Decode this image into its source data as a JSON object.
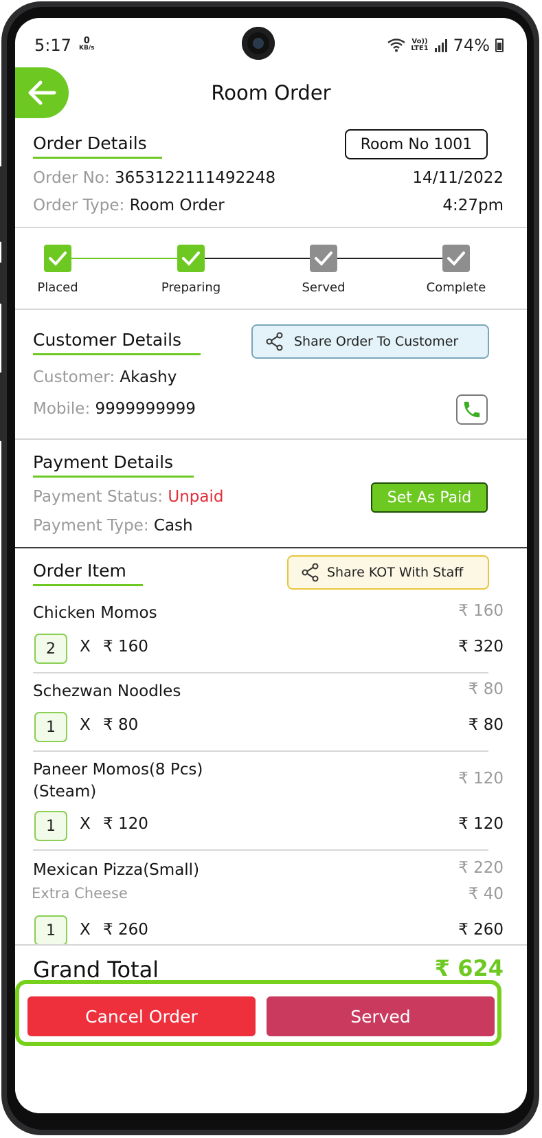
{
  "status_bar": {
    "time": "5:17",
    "net_speed_value": "0",
    "net_speed_unit": "KB/s",
    "volte_line1": "Vo))",
    "volte_line2": "LTE1",
    "battery": "74%"
  },
  "header": {
    "title": "Room Order"
  },
  "order_details": {
    "heading": "Order Details",
    "room_badge": "Room No 1001",
    "order_no_label": "Order No:",
    "order_no_value": "3653122111492248",
    "date": "14/11/2022",
    "order_type_label": "Order Type:",
    "order_type_value": "Room Order",
    "time": "4:27pm"
  },
  "progress": {
    "steps": [
      {
        "label": "Placed",
        "done": true
      },
      {
        "label": "Preparing",
        "done": true
      },
      {
        "label": "Served",
        "done": false
      },
      {
        "label": "Complete",
        "done": false
      }
    ]
  },
  "customer_details": {
    "heading": "Customer Details",
    "share_button": "Share Order To Customer",
    "customer_label": "Customer:",
    "customer_value": "Akashy",
    "mobile_label": "Mobile:",
    "mobile_value": "9999999999"
  },
  "payment_details": {
    "heading": "Payment Details",
    "status_label": "Payment Status:",
    "status_value": "Unpaid",
    "set_paid_button": "Set As Paid",
    "type_label": "Payment Type:",
    "type_value": "Cash"
  },
  "order_items": {
    "heading": "Order Item",
    "share_kot_button": "Share KOT With Staff",
    "items": [
      {
        "name": "Chicken Momos",
        "unit_price": "₹ 160",
        "qty": "2",
        "x": "X",
        "price_each": "₹ 160",
        "line_total": "₹ 320"
      },
      {
        "name": "Schezwan Noodles",
        "unit_price": "₹ 80",
        "qty": "1",
        "x": "X",
        "price_each": "₹ 80",
        "line_total": "₹ 80"
      },
      {
        "name_line1": "Paneer Momos(8 Pcs)",
        "name_line2": "(Steam)",
        "unit_price": "₹ 120",
        "qty": "1",
        "x": "X",
        "price_each": "₹ 120",
        "line_total": "₹ 120"
      },
      {
        "name": "Mexican Pizza(Small)",
        "unit_price": "₹ 220",
        "addon": "Extra Cheese",
        "addon_price": "₹ 40",
        "qty": "1",
        "x": "X",
        "price_each": "₹ 260",
        "line_total": "₹ 260"
      }
    ]
  },
  "footer": {
    "grand_total_label": "Grand Total",
    "grand_total_value": "₹ 624",
    "cancel_button": "Cancel Order",
    "served_button": "Served"
  },
  "colors": {
    "accent_green": "#6dc922",
    "cancel_red": "#ee2f3c",
    "served_maroon": "#c93a5e",
    "unpaid_red": "#e0303a",
    "share_customer_bg": "#e3f3f9",
    "share_kot_bg": "#fdf8e4"
  }
}
